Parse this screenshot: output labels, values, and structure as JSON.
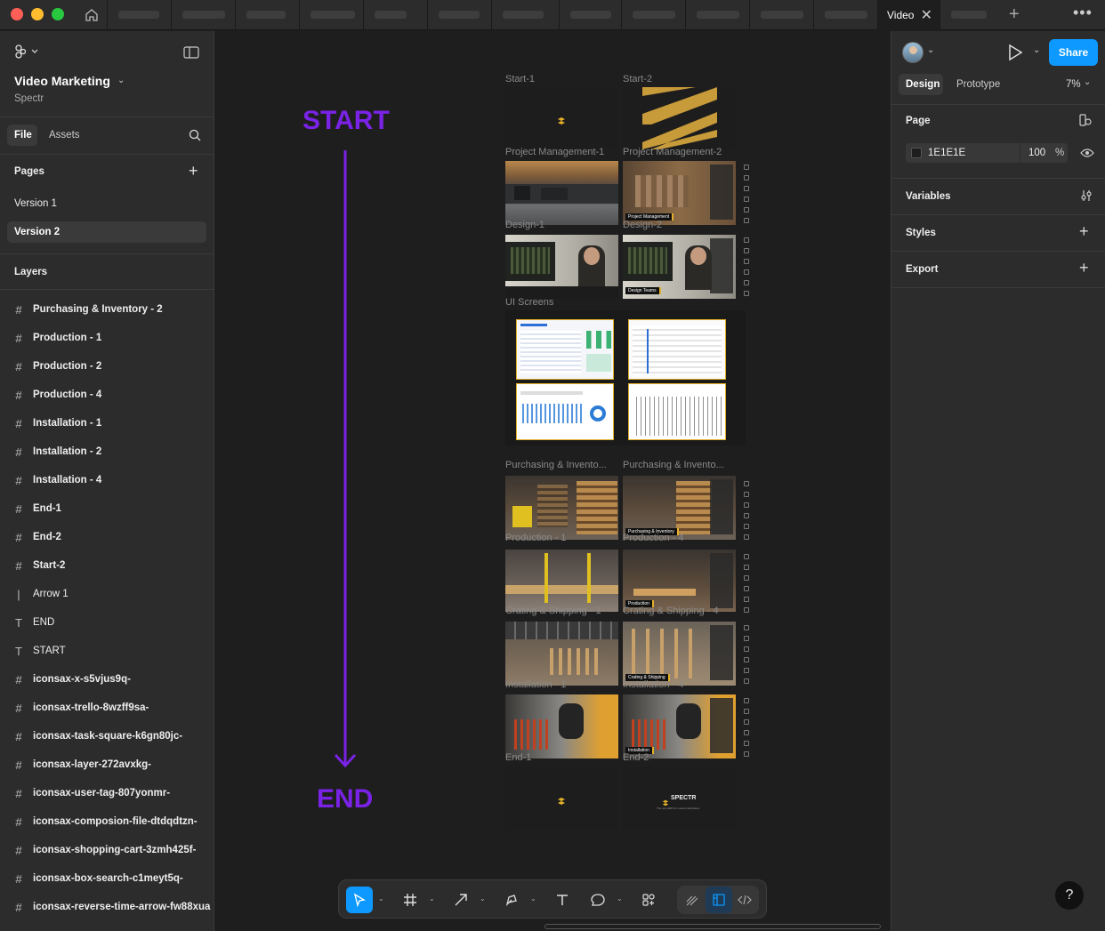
{
  "titlebar": {
    "active_tab": "Video Marketing",
    "colors": {
      "close": "#ff5f57",
      "minimize": "#febc2e",
      "maximize": "#28c840"
    }
  },
  "file": {
    "name": "Video Marketing",
    "project": "Spectr"
  },
  "left_tabs": {
    "file": "File",
    "assets": "Assets"
  },
  "pages": {
    "heading": "Pages",
    "items": [
      "Version 1",
      "Version 2"
    ],
    "selected": "Version 2"
  },
  "layers": {
    "heading": "Layers",
    "items": [
      {
        "name": "Purchasing & Inventory - 2",
        "icon": "frame-icon"
      },
      {
        "name": "Production - 1",
        "icon": "frame-icon"
      },
      {
        "name": "Production - 2",
        "icon": "frame-icon"
      },
      {
        "name": "Production - 4",
        "icon": "frame-icon"
      },
      {
        "name": "Installation - 1",
        "icon": "frame-icon"
      },
      {
        "name": "Installation - 2",
        "icon": "frame-icon"
      },
      {
        "name": "Installation - 4",
        "icon": "frame-icon"
      },
      {
        "name": "End-1",
        "icon": "frame-icon"
      },
      {
        "name": "End-2",
        "icon": "frame-icon"
      },
      {
        "name": "Start-2",
        "icon": "frame-icon"
      },
      {
        "name": "Arrow 1",
        "icon": "line-icon"
      },
      {
        "name": "END",
        "icon": "text-icon"
      },
      {
        "name": "START",
        "icon": "text-icon"
      },
      {
        "name": "iconsax-x-s5vjus9q-",
        "icon": "frame-icon"
      },
      {
        "name": "iconsax-trello-8wzff9sa-",
        "icon": "frame-icon"
      },
      {
        "name": "iconsax-task-square-k6gn80jc-",
        "icon": "frame-icon"
      },
      {
        "name": "iconsax-layer-272avxkg-",
        "icon": "frame-icon"
      },
      {
        "name": "iconsax-user-tag-807yonmr-",
        "icon": "frame-icon"
      },
      {
        "name": "iconsax-composion-file-dtdqdtzn-",
        "icon": "frame-icon"
      },
      {
        "name": "iconsax-shopping-cart-3zmh425f-",
        "icon": "frame-icon"
      },
      {
        "name": "iconsax-box-search-c1meyt5q-",
        "icon": "frame-icon"
      },
      {
        "name": "iconsax-reverse-time-arrow-fw88xua",
        "icon": "frame-icon"
      }
    ]
  },
  "canvas": {
    "start_text": "START",
    "end_text": "END",
    "accent": "#7a22e6",
    "frame_labels": {
      "start1": "Start-1",
      "start2": "Start-2",
      "pm1": "Project Management-1",
      "pm2": "Project Management-2",
      "design1": "Design-1",
      "design2": "Design-2",
      "ui": "UI Screens",
      "pi1": "Purchasing & Invento...",
      "pi2": "Purchasing & Invento...",
      "prod1": "Production - 1",
      "prod4": "Production - 4",
      "crate1": "Crating & Shipping - 1",
      "crate4": "Crating & Shipping - 4",
      "inst1": "Installation - 1",
      "inst4": "Installation - 4",
      "end1": "End-1",
      "end2": "End-2"
    },
    "captions": {
      "pm": "Project Management",
      "design": "Design Teams",
      "pi": "Purchasing & Inventory",
      "prod": "Production",
      "crate": "Crating & Shipping",
      "inst": "Installation"
    },
    "end2_brand": "SPECTR",
    "end2_tagline": "The only ERP for custom fabricators"
  },
  "right": {
    "tabs": {
      "design": "Design",
      "prototype": "Prototype"
    },
    "zoom": "7%",
    "share": "Share",
    "page_heading": "Page",
    "page_color": "1E1E1E",
    "page_opacity": "100",
    "percent": "%",
    "variables": "Variables",
    "styles": "Styles",
    "export": "Export",
    "share_color": "#0d99ff"
  },
  "help": "?"
}
